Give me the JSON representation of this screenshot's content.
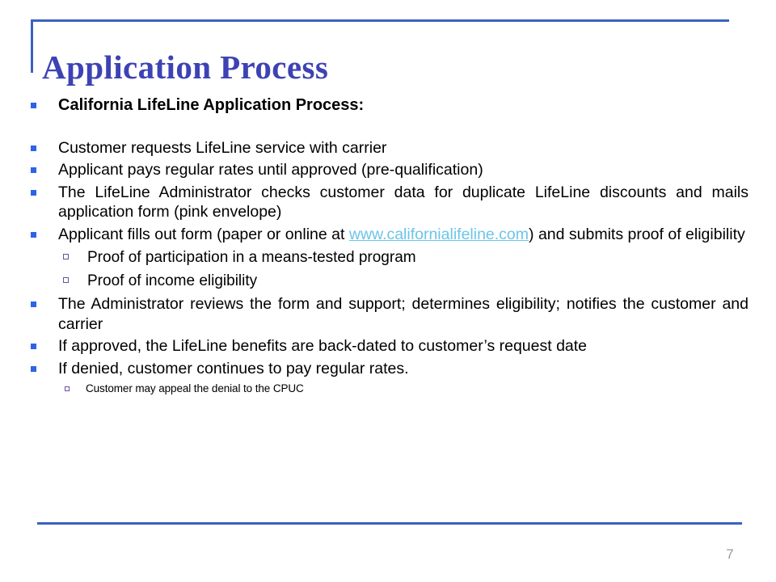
{
  "slide": {
    "title": "Application Process",
    "page_number": "7",
    "colors": {
      "title_text": "#3D42B4",
      "rule": "#3A62BF",
      "bullet_level1": "#2D63E8",
      "bullet_level2": "#6B4F9E",
      "link": "#6CC5E8",
      "body_text": "#000000",
      "page_number": "#9A9A9A",
      "background": "#FFFFFF"
    }
  },
  "content": {
    "heading_bullet": "California LifeLine Application Process:",
    "bullets": [
      {
        "text": "Customer requests  LifeLine service with carrier"
      },
      {
        "text": "Applicant pays regular rates until approved (pre-qualification)"
      },
      {
        "text": "The LifeLine Administrator checks customer data for duplicate LifeLine discounts and mails application form (pink envelope)"
      },
      {
        "text_before_link": "Applicant fills out form (paper or online at ",
        "link_text": "www.californialifeline.com",
        "text_after_link": ") and submits proof of eligibility",
        "sub_bullets": [
          "Proof of participation in a means-tested program",
          "Proof of income eligibility"
        ]
      },
      {
        "text": "The Administrator reviews the form and support; determines eligibility; notifies the customer and carrier"
      },
      {
        "text": "If approved, the LifeLine benefits are back-dated to customer’s request date"
      },
      {
        "text": "If denied, customer continues to pay regular rates.",
        "sub_bullets_small": [
          "Customer may appeal the denial to the CPUC"
        ]
      }
    ]
  }
}
